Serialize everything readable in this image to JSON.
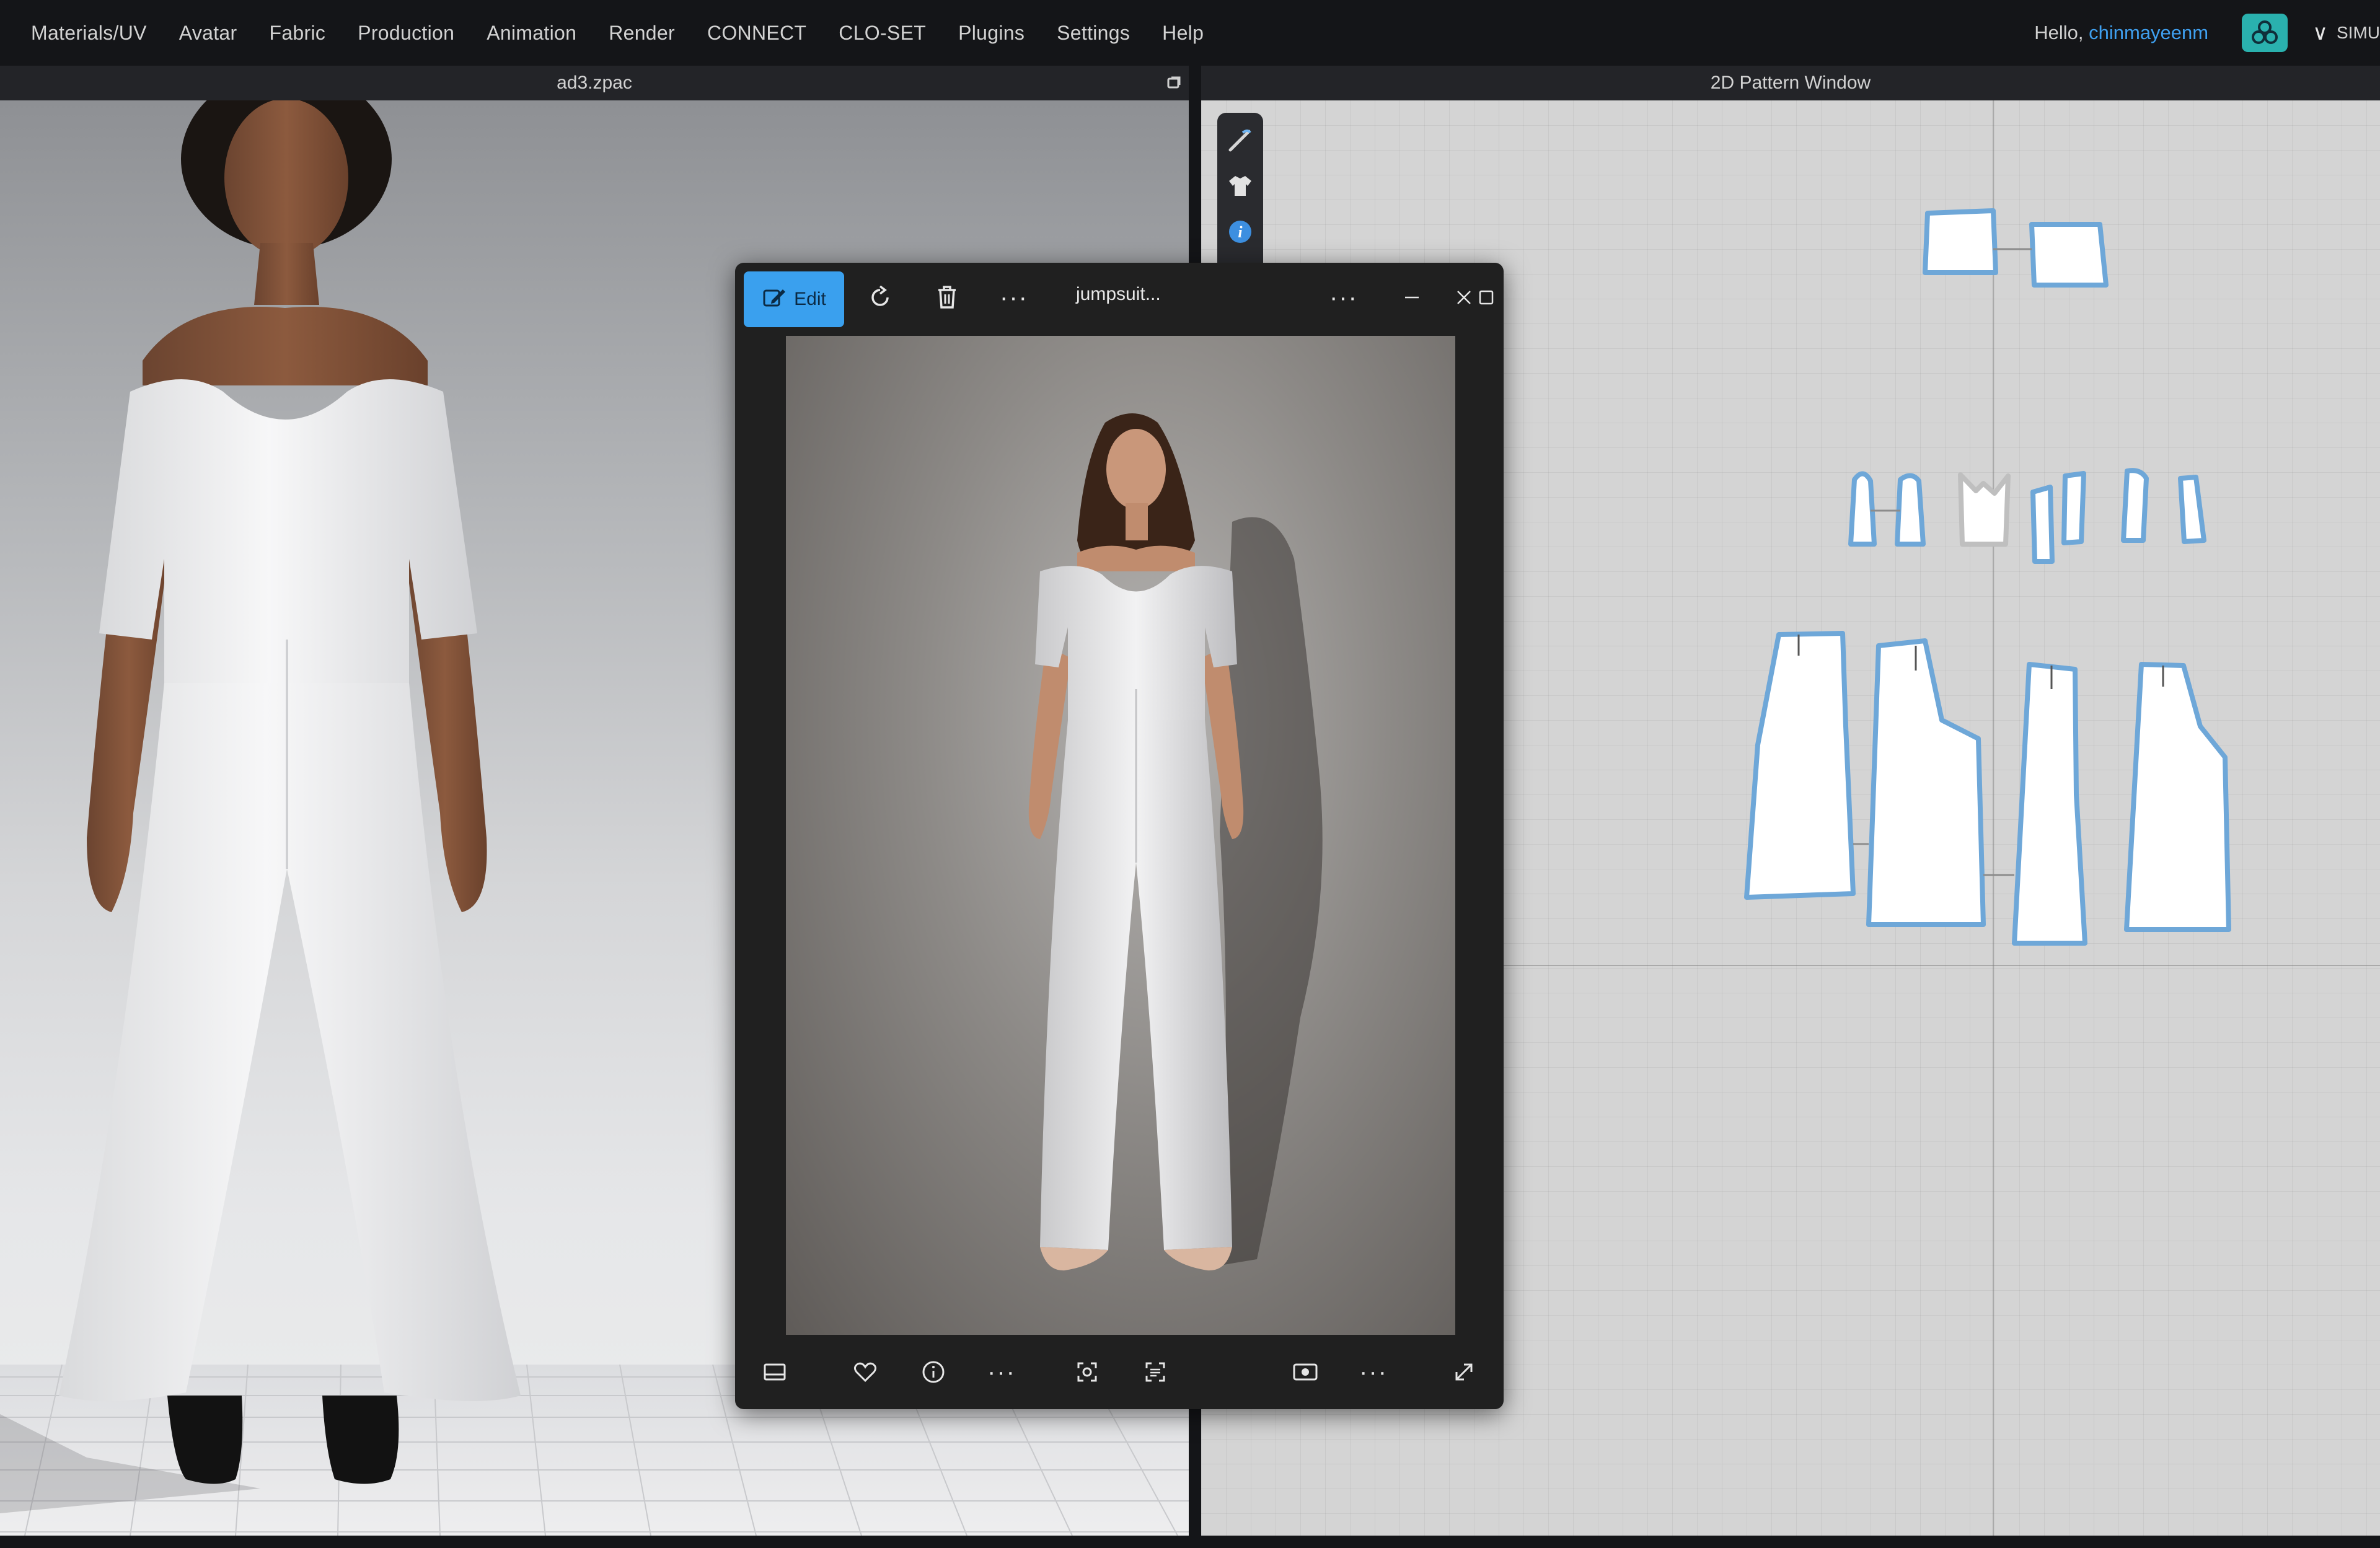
{
  "menu": {
    "items": [
      "Materials/UV",
      "Avatar",
      "Fabric",
      "Production",
      "Animation",
      "Render",
      "CONNECT",
      "CLO-SET",
      "Plugins",
      "Settings",
      "Help"
    ]
  },
  "user": {
    "greeting_prefix": "Hello, ",
    "username": "chinmayeenm",
    "simulation_label": "SIMU"
  },
  "viewport3d": {
    "file_title": "ad3.zpac"
  },
  "pattern_window": {
    "title": "2D Pattern Window"
  },
  "photo_viewer": {
    "edit_label": "Edit",
    "file_name": "jumpsuit...",
    "top_icons": [
      "edit-pencil-icon",
      "rotate-icon",
      "delete-icon",
      "more-icon",
      "more-icon",
      "minimize-icon",
      "maximize-icon",
      "close-icon"
    ],
    "bottom_icons": [
      "filmstrip-icon",
      "favorite-heart-icon",
      "info-icon",
      "more-icon",
      "crop-scan-icon",
      "text-scan-icon",
      "live-photo-icon",
      "more-icon",
      "fullscreen-icon"
    ]
  },
  "colors": {
    "accent": "#3aa0ee",
    "username": "#3fa0f0",
    "connect_logo": "#2ab1ae",
    "menubar_bg": "#141518",
    "pattern_outline": "#6ea7d8"
  }
}
